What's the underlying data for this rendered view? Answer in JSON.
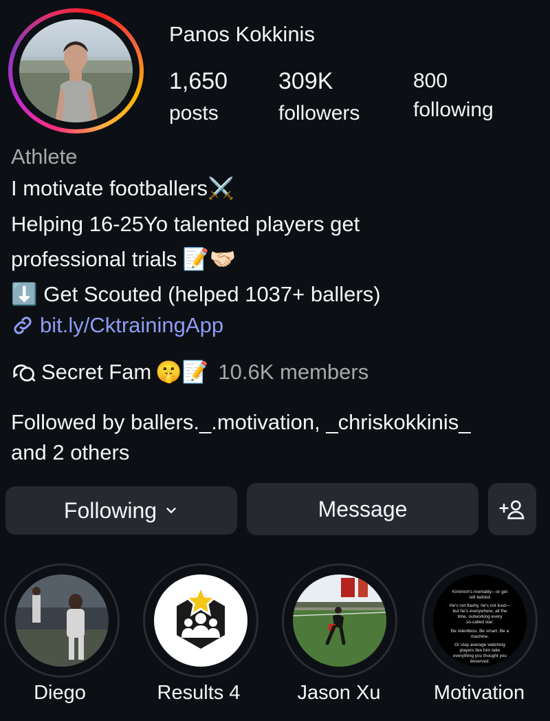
{
  "profile": {
    "name": "Panos Kokkinis",
    "stats": {
      "posts_value": "1,650",
      "posts_label": "posts",
      "followers_value": "309K",
      "followers_label": "followers",
      "following_value": "800",
      "following_label": "following"
    },
    "category": "Athlete",
    "bio": {
      "line1": "I motivate footballers",
      "line1_emoji": "⚔️",
      "line2": "Helping 16-25Yo talented players get",
      "line3": "professional trials",
      "line3_emoji": "📝🤝🏻",
      "line4_emoji": "⬇️",
      "line4": "Get Scouted (helped 1037+ ballers)"
    },
    "link": "bit.ly/CktrainingApp",
    "channel": {
      "name": "Secret Fam",
      "emoji": "🤫📝",
      "members": "10.6K members"
    },
    "followed_by": {
      "line1": "Followed by ballers._.motivation, _chriskokkinis_",
      "line2": "and 2 others"
    }
  },
  "actions": {
    "following_label": "Following",
    "message_label": "Message"
  },
  "highlights": [
    {
      "label": "Diego"
    },
    {
      "label": "Results 4"
    },
    {
      "label": "Jason Xu"
    },
    {
      "label": "Motivation"
    }
  ],
  "motivation_thumb": {
    "l1": "Kimmich's mentality—or get",
    "l2": "left behind",
    "l3": "He's not flashy, he's not loud—",
    "l4": "but he's everywhere, all the",
    "l5": "time, outworking every",
    "l6": "so-called star.",
    "l7": "Be relentless. Be smart. Be a",
    "l8": "machine.",
    "l9": "Or stay average watching",
    "l10": "players like him take",
    "l11": "everything you thought you",
    "l12": "deserved."
  },
  "colors": {
    "background": "#0c1014",
    "button_bg": "#262a30",
    "link": "#8e9cf4",
    "muted": "#a8a8a8"
  }
}
